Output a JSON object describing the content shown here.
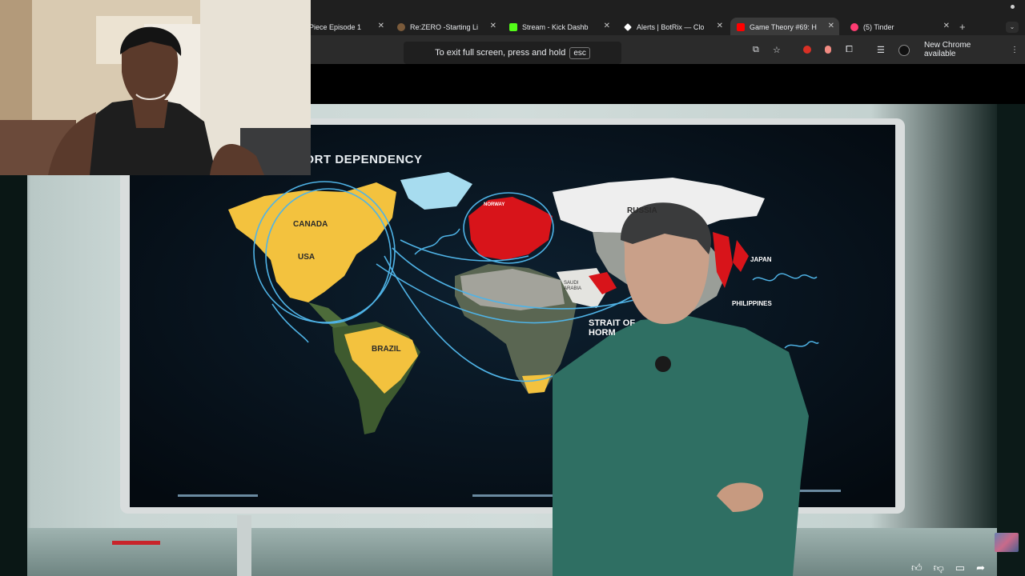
{
  "browser": {
    "tabs": [
      {
        "title": "Piece Episode 1",
        "favicon_color": "#ffffff"
      },
      {
        "title": "Re:ZERO -Starting Li",
        "favicon_color": "#f5a623"
      },
      {
        "title": "Stream - Kick Dashb",
        "favicon_color": "#53fc18"
      },
      {
        "title": "Alerts | BotRix — Clo",
        "favicon_color": "#ffffff"
      },
      {
        "title": "Game Theory #69: H",
        "favicon_color": "#ff0000",
        "active": true
      },
      {
        "title": "(5) Tinder",
        "favicon_color": "#fe3c72"
      }
    ],
    "new_tab_icon": "+",
    "fullscreen_hint": {
      "text": "To exit full screen, press and hold",
      "key": "esc"
    },
    "update_button": "New Chrome available"
  },
  "map": {
    "title": "PORT DEPENDENCY",
    "labels": {
      "canada": "CANADA",
      "usa": "USA",
      "brazil": "BRAZIL",
      "russia": "RUSSIA",
      "japan": "JAPAN",
      "philippines": "PHILIPPINES",
      "norway": "NORWAY",
      "saudi": "SAUDI ARABIA",
      "hormuz_1": "STRAIT OF",
      "hormuz_2": "HORM"
    }
  },
  "colors": {
    "highlight_yellow": "#f3c23e",
    "route_blue": "#4fb3e6",
    "dependency_red": "#d8141a"
  },
  "player_controls": [
    "like-icon",
    "dislike-icon",
    "comment-icon",
    "share-icon"
  ]
}
